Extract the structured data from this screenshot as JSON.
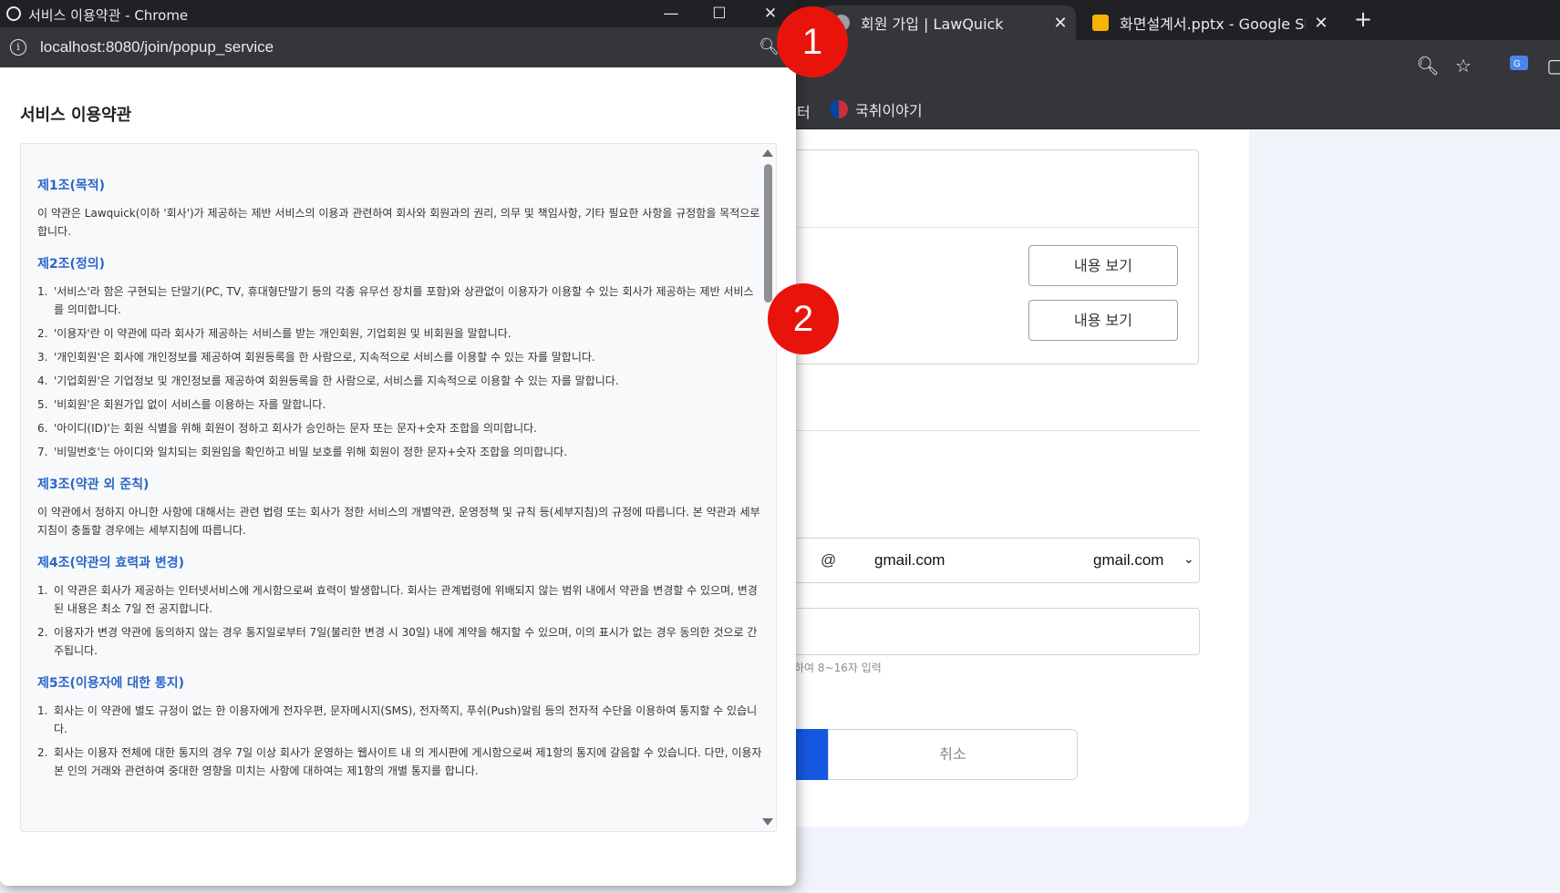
{
  "browser": {
    "tabs": [
      {
        "title": "회원 가입 | LawQuick",
        "close": "✕"
      },
      {
        "title": "화면설계서.pptx - Google Slides",
        "close": "✕"
      }
    ],
    "new_tab": "+",
    "bookmarks": {
      "fragment": "터",
      "item": "국취이야기"
    }
  },
  "page": {
    "view_buttons": [
      "내용 보기",
      "내용 보기"
    ],
    "email": {
      "at": "@",
      "domain": "gmail.com",
      "select_value": "gmail.com"
    },
    "password_hint": "하여 8~16자 입력",
    "cancel_label": "취소"
  },
  "annotations": [
    "1",
    "2"
  ],
  "popup": {
    "window_title": "서비스 이용약관 - Chrome",
    "url": "localhost:8080/join/popup_service",
    "heading": "서비스 이용약관",
    "articles": [
      {
        "title": "제1조(목적)",
        "text": "이 약관은 Lawquick(이하 '회사')가 제공하는 제반 서비스의 이용과 관련하여 회사와 회원과의 권리, 의무 및 책임사항, 기타 필요한 사항을 규정함을 목적으로 합니다."
      },
      {
        "title": "제2조(정의)",
        "items": [
          "'서비스'라 함은 구현되는 단말기(PC, TV, 휴대형단말기 등의 각종 유무선 장치를 포함)와 상관없이 이용자가 이용할 수 있는 회사가 제공하는 제반 서비스를 의미합니다.",
          "'이용자'란 이 약관에 따라 회사가 제공하는 서비스를 받는 개인회원, 기업회원 및 비회원을 말합니다.",
          "'개인회원'은 회사에 개인정보를 제공하여 회원등록을 한 사람으로, 지속적으로 서비스를 이용할 수 있는 자를 말합니다.",
          "'기업회원'은 기업정보 및 개인정보를 제공하여 회원등록을 한 사람으로, 서비스를 지속적으로 이용할 수 있는 자를 말합니다.",
          "'비회원'은 회원가입 없이 서비스를 이용하는 자를 말합니다.",
          "'아이디(ID)'는 회원 식별을 위해 회원이 정하고 회사가 승인하는 문자 또는 문자+숫자 조합을 의미합니다.",
          "'비밀번호'는 아이디와 일치되는 회원임을 확인하고 비밀 보호를 위해 회원이 정한 문자+숫자 조합을 의미합니다."
        ]
      },
      {
        "title": "제3조(약관 외 준칙)",
        "text": "이 약관에서 정하지 아니한 사항에 대해서는 관련 법령 또는 회사가 정한 서비스의 개별약관, 운영정책 및 규칙 등(세부지침)의 규정에 따릅니다. 본 약관과 세부지침이 충돌할 경우에는 세부지침에 따릅니다."
      },
      {
        "title": "제4조(약관의 효력과 변경)",
        "items": [
          "이 약관은 회사가 제공하는 인터넷서비스에 게시함으로써 효력이 발생합니다. 회사는 관계법령에 위배되지 않는 범위 내에서 약관을 변경할 수 있으며, 변경된 내용은 최소 7일 전 공지합니다.",
          "이용자가 변경 약관에 동의하지 않는 경우 통지일로부터 7일(불리한 변경 시 30일) 내에 계약을 해지할 수 있으며, 이의 표시가 없는 경우 동의한 것으로 간주됩니다."
        ]
      },
      {
        "title": "제5조(이용자에 대한 통지)",
        "items": [
          "회사는 이 약관에 별도 규정이 없는 한 이용자에게 전자우편, 문자메시지(SMS), 전자쪽지, 푸쉬(Push)알림 등의 전자적 수단을 이용하여 통지할 수 있습니다.",
          "회사는 이용자 전체에 대한 통지의 경우 7일 이상 회사가 운영하는 웹사이트 내 의 게시판에 게시함으로써 제1항의 통지에 갈음할 수 있습니다. 다만, 이용자 본 인의 거래와 관련하여 중대한 영향을 미치는 사항에 대하여는 제1항의 개별 통지를 합니다."
        ]
      }
    ]
  }
}
